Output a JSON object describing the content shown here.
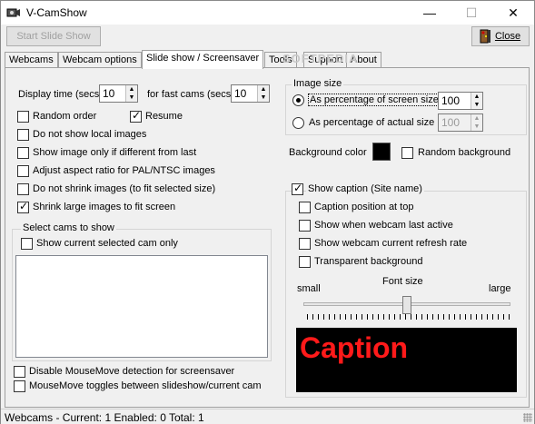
{
  "window": {
    "title": "V-CamShow",
    "minimize_glyph": "—",
    "maximize_glyph": "☐",
    "close_glyph": "✕"
  },
  "toolbar": {
    "start_label": "Start Slide Show",
    "close_label": "Close"
  },
  "tabs": [
    {
      "label": "Webcams"
    },
    {
      "label": "Webcam options"
    },
    {
      "label": "Slide show / Screensaver"
    },
    {
      "label": "Tools"
    },
    {
      "label": "Support"
    },
    {
      "label": "About"
    }
  ],
  "watermark": "SOFTPEDIA",
  "timing": {
    "display_time_label": "Display time (secs)",
    "display_time_value": "10",
    "fast_cams_label": "for fast cams (secs)",
    "fast_cams_value": "10"
  },
  "options": {
    "random_order": "Random order",
    "resume": "Resume",
    "no_local": "Do not show local images",
    "if_different": "Show image only if different from last",
    "aspect": "Adjust aspect ratio for PAL/NTSC images",
    "no_shrink": "Do not shrink images (to fit selected size)",
    "shrink_large": "Shrink large images to fit screen"
  },
  "select_cams": {
    "title": "Select cams to show",
    "current_only": "Show current selected cam only"
  },
  "mouse": {
    "disable_detection": "Disable MouseMove detection for screensaver",
    "toggles": "MouseMove toggles between slideshow/current cam"
  },
  "image_size": {
    "title": "Image size",
    "pct_screen_label": "As percentage of screen size",
    "pct_screen_value": "100",
    "pct_actual_label": "As percentage of actual size",
    "pct_actual_value": "100"
  },
  "background": {
    "color_label": "Background color",
    "color": "#000000",
    "random_label": "Random background"
  },
  "caption": {
    "show_label": "Show caption (Site name)",
    "at_top": "Caption position at top",
    "last_active": "Show when webcam last active",
    "refresh_rate": "Show webcam current refresh rate",
    "transparent": "Transparent background",
    "font_size_label": "Font size",
    "small_label": "small",
    "large_label": "large",
    "font_size_fraction": 0.5,
    "preview_text": "Caption",
    "preview_color": "#ff1a1a"
  },
  "status": {
    "text": "Webcams - Current: 1  Enabled: 0  Total: 1"
  }
}
